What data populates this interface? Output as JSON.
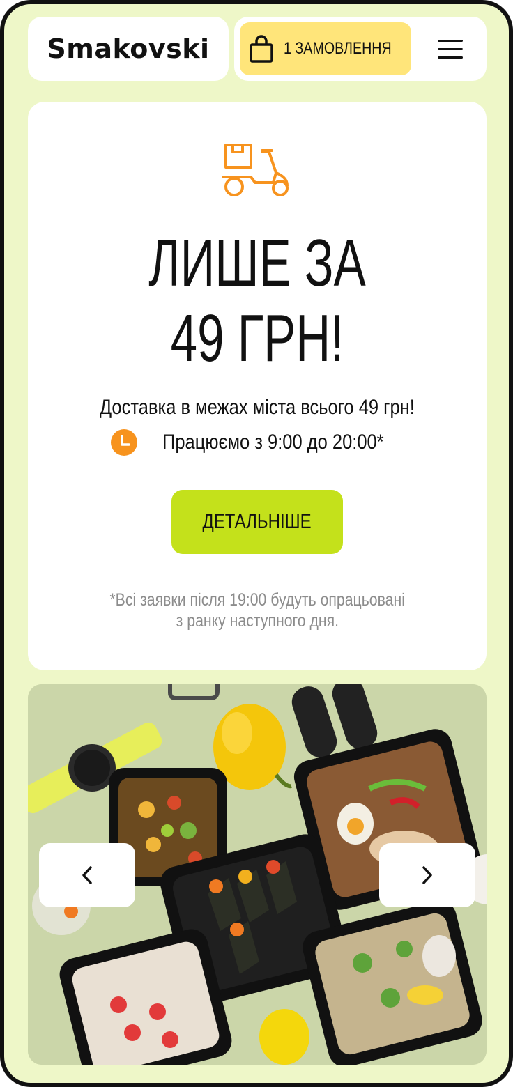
{
  "header": {
    "logo": "Smakovski",
    "order_button": {
      "label": "1 ЗАМОВЛЕННЯ",
      "icon": "shopping-bag-icon"
    },
    "menu_icon": "hamburger-menu-icon"
  },
  "promo": {
    "icon": "delivery-scooter-icon",
    "headline_line1": "ЛИШЕ ЗА",
    "headline_line2": "49 ГРН!",
    "subtitle": "Доставка в межах міста всього 49 грн!",
    "hours": "Працюємо з 9:00 до 20:00*",
    "hours_icon": "clock-icon",
    "more_button": "ДЕТАЛЬНІШЕ",
    "note_line1": "*Всі заявки після 19:00 будуть опрацьовані",
    "note_line2": "з ранку наступного дня."
  },
  "slider": {
    "prev_icon": "chevron-left-icon",
    "next_icon": "chevron-right-icon"
  },
  "colors": {
    "background": "#eef7c8",
    "accent_yellow": "#ffe57a",
    "accent_green": "#c4e11b",
    "icon_orange": "#f7931e"
  }
}
